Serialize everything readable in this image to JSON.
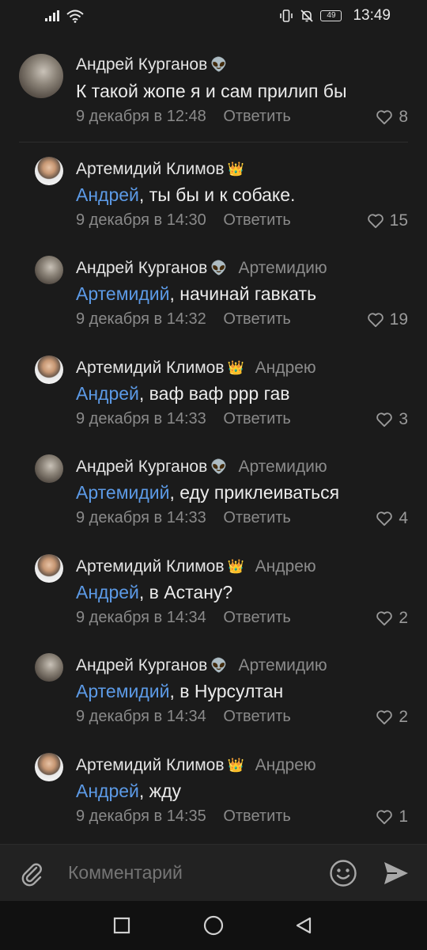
{
  "status_bar": {
    "time": "13:49",
    "battery": "49",
    "icons": [
      "signal-icon",
      "wifi-icon",
      "vibrate-icon",
      "mute-icon",
      "battery-icon"
    ]
  },
  "comments": [
    {
      "author": "Андрей Курганов",
      "badge": "👽",
      "reply_to": "",
      "mention": "",
      "text": "К такой жопе я и сам прилип бы",
      "date": "9 декабря в 12:48",
      "reply_label": "Ответить",
      "likes": "8"
    },
    {
      "author": "Артемидий Климов",
      "badge": "👑",
      "reply_to": "",
      "mention": "Андрей",
      "text": ", ты бы и к собаке.",
      "date": "9 декабря в 14:30",
      "reply_label": "Ответить",
      "likes": "15"
    },
    {
      "author": "Андрей Курганов",
      "badge": "👽",
      "reply_to": "Артемидию",
      "mention": "Артемидий",
      "text": ", начинай гавкать",
      "date": "9 декабря в 14:32",
      "reply_label": "Ответить",
      "likes": "19"
    },
    {
      "author": "Артемидий Климов",
      "badge": "👑",
      "reply_to": "Андрею",
      "mention": "Андрей",
      "text": ", ваф ваф ррр гав",
      "date": "9 декабря в 14:33",
      "reply_label": "Ответить",
      "likes": "3"
    },
    {
      "author": "Андрей Курганов",
      "badge": "👽",
      "reply_to": "Артемидию",
      "mention": "Артемидий",
      "text": ", еду приклеиваться",
      "date": "9 декабря в 14:33",
      "reply_label": "Ответить",
      "likes": "4"
    },
    {
      "author": "Артемидий Климов",
      "badge": "👑",
      "reply_to": "Андрею",
      "mention": "Андрей",
      "text": ", в Астану?",
      "date": "9 декабря в 14:34",
      "reply_label": "Ответить",
      "likes": "2"
    },
    {
      "author": "Андрей Курганов",
      "badge": "👽",
      "reply_to": "Артемидию",
      "mention": "Артемидий",
      "text": ", в Нурсултан",
      "date": "9 декабря в 14:34",
      "reply_label": "Ответить",
      "likes": "2"
    },
    {
      "author": "Артемидий Климов",
      "badge": "👑",
      "reply_to": "Андрею",
      "mention": "Андрей",
      "text": ", жду",
      "date": "9 декабря в 14:35",
      "reply_label": "Ответить",
      "likes": "1"
    }
  ],
  "composer": {
    "placeholder": "Комментарий",
    "icons": [
      "paperclip-icon",
      "emoji-icon",
      "send-icon"
    ]
  },
  "navbar": {
    "icons": [
      "recent-apps-icon",
      "home-icon",
      "back-icon"
    ]
  },
  "colors": {
    "background": "#1b1b1b",
    "mention": "#5c9ae6",
    "secondary_text": "#8a8a8a"
  }
}
